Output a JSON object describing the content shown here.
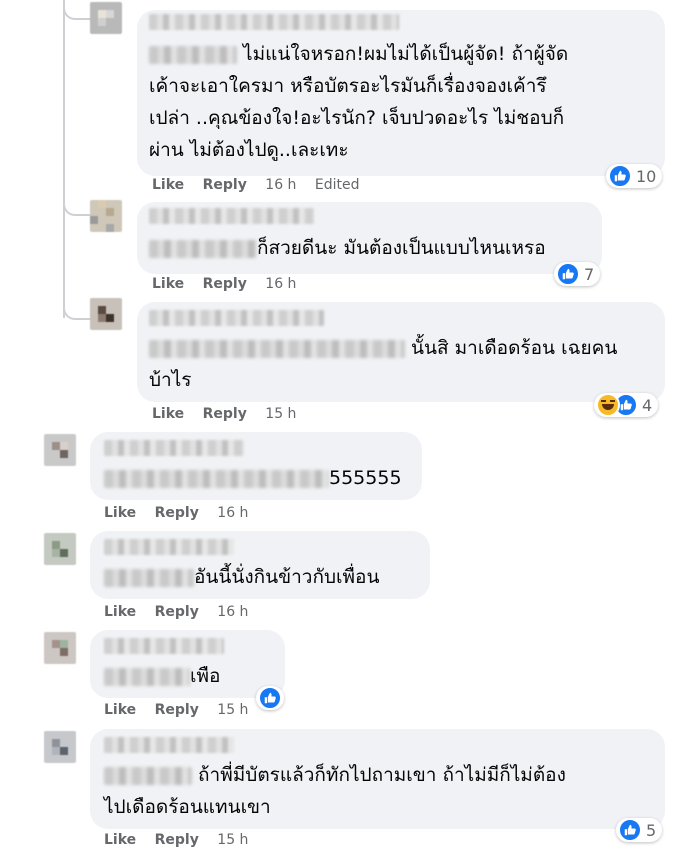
{
  "actions": {
    "like": "Like",
    "reply": "Reply"
  },
  "comments": [
    {
      "lines": [
        "ไม่แน่ใจหรอก!ผมไม่ได้เป็นผู้จัด! ถ้าผู้จัด",
        "เค้าจะเอาใครมา หรือบัตรอะไรมันก็เรื่องจองเค้ารึ",
        "เปล่า ..คุณข้องใจ!อะไรนัก? เจ็บปวดอะไร ไม่ชอบก็",
        "ผ่าน ไม่ต้องไปดู..เละเทะ"
      ],
      "time": "16 h",
      "edited": "Edited",
      "reactions": {
        "types": [
          "like"
        ],
        "count": "10"
      }
    },
    {
      "lines": [
        "ก็สวยดีนะ มันต้องเป็นแบบไหนเหรอ"
      ],
      "time": "16 h",
      "reactions": {
        "types": [
          "like"
        ],
        "count": "7"
      }
    },
    {
      "lines": [
        "นั้นสิ มาเดือดร้อน เฉยคน",
        "บ้าไร"
      ],
      "time": "15 h",
      "reactions": {
        "types": [
          "haha",
          "like"
        ],
        "count": "4"
      }
    },
    {
      "lines": [
        "555555"
      ],
      "time": "16 h"
    },
    {
      "lines": [
        "อันนี้นั่งกินข้าวกับเพื่อน"
      ],
      "time": "16 h"
    },
    {
      "lines": [
        "เพือ"
      ],
      "time": "15 h",
      "reactions": {
        "types": [
          "like"
        ],
        "count": ""
      }
    },
    {
      "lines": [
        "ถ้าพี่มีบัตรแล้วก็ทักไปถามเขา ถ้าไม่มีก็ไม่ต้อง",
        "ไปเดือดร้อนแทนเขา"
      ],
      "time": "15 h",
      "reactions": {
        "types": [
          "like"
        ],
        "count": "5"
      }
    }
  ]
}
